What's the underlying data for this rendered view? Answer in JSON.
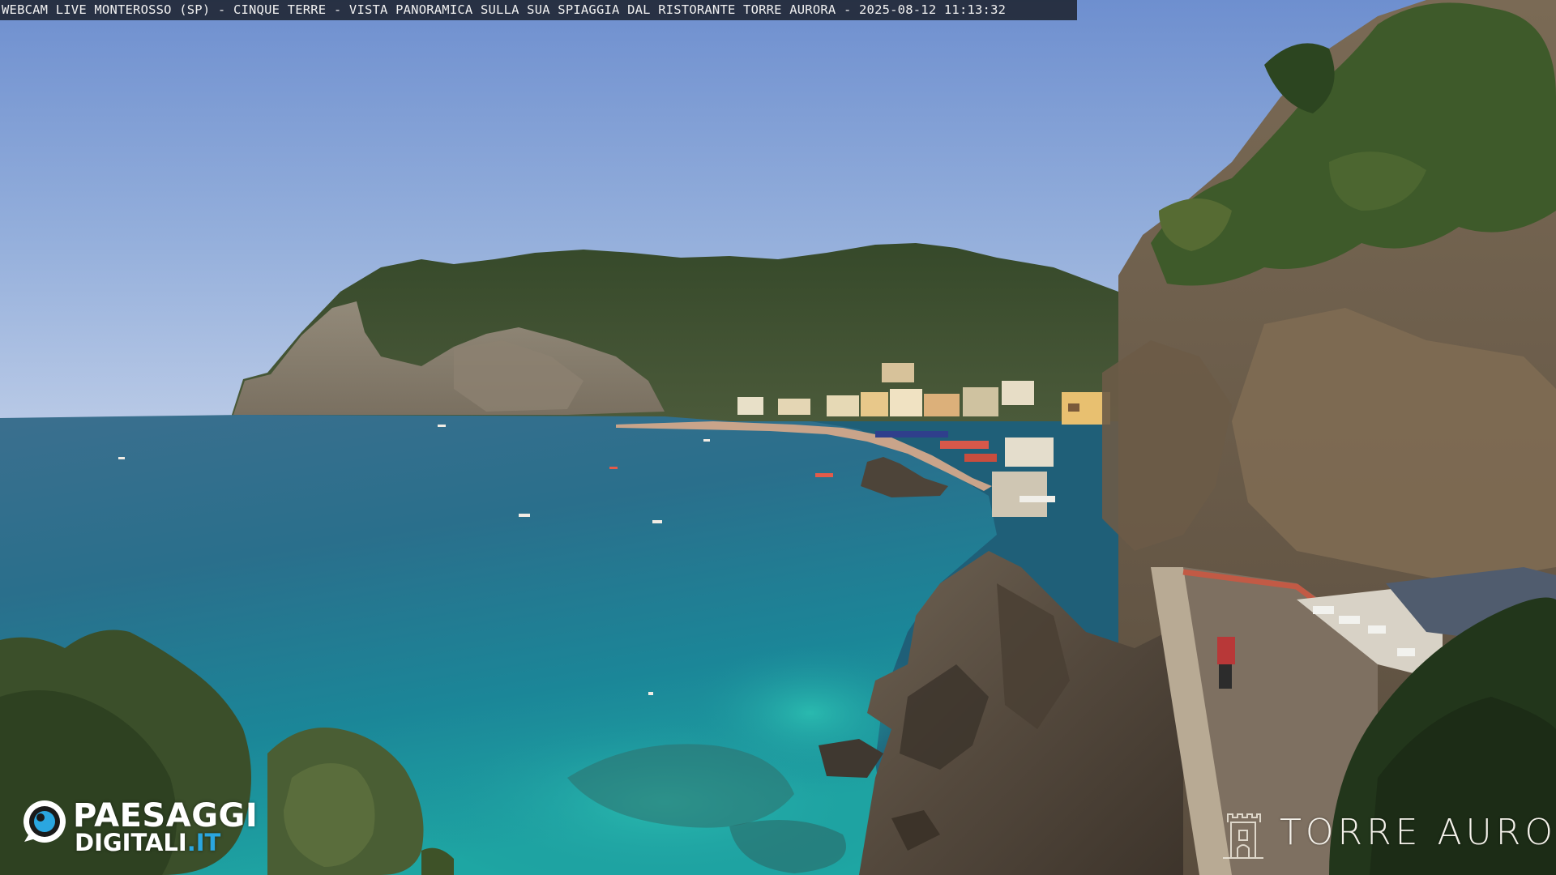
{
  "overlay": {
    "caption": "WEBCAM LIVE MONTEROSSO (SP) - CINQUE TERRE - VISTA PANORAMICA SULLA SUA SPIAGGIA DAL RISTORANTE TORRE AURORA - 2025-08-12 11:13:32"
  },
  "branding": {
    "logo_line1": "PAESAGGI",
    "logo_line2_main": "DIGITALI",
    "logo_line2_tld": ".IT",
    "logo_icon": "eye-lens-icon",
    "accent_color": "#2aa6e0"
  },
  "sponsor": {
    "name": "TORRE AURORA",
    "emblem_icon": "tower-emblem-icon"
  }
}
